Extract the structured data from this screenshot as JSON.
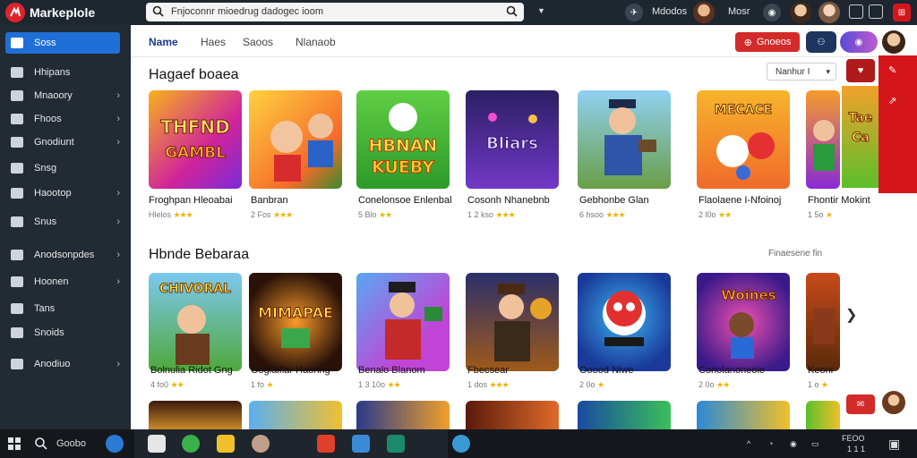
{
  "app": {
    "title": "Markeplole",
    "logo_icon": "marketplace-logo-icon"
  },
  "search": {
    "value": "Fnjoconnr mioedrug dadogec ioom"
  },
  "topbar": {
    "label_1": "Mdodos",
    "label_2": "Mosr"
  },
  "sidebar": {
    "items": [
      {
        "label": "Soss",
        "icon": "home-icon",
        "active": true,
        "chevron": false
      },
      {
        "label": "Hhipans",
        "icon": "grid-icon",
        "active": false,
        "chevron": false
      },
      {
        "label": "Mnaoory",
        "icon": "folder-icon",
        "active": false,
        "chevron": true
      },
      {
        "label": "Fhoos",
        "icon": "book-icon",
        "active": false,
        "chevron": true
      },
      {
        "label": "Gnodiunt",
        "icon": "gamepad-icon",
        "active": false,
        "chevron": true
      },
      {
        "label": "Snsg",
        "icon": "tag-icon",
        "active": false,
        "chevron": false
      },
      {
        "label": "Haootop",
        "icon": "monitor-icon",
        "active": false,
        "chevron": true
      },
      {
        "label": "Snus",
        "icon": "settings-icon",
        "active": false,
        "chevron": true
      },
      {
        "label": "Anodsonpdes",
        "icon": "puzzle-icon",
        "active": false,
        "chevron": true
      },
      {
        "label": "Hoonen",
        "icon": "list-icon",
        "active": false,
        "chevron": true
      },
      {
        "label": "Tans",
        "icon": "star-icon",
        "active": false,
        "chevron": false
      },
      {
        "label": "Snoids",
        "icon": "layers-icon",
        "active": false,
        "chevron": false
      },
      {
        "label": "Anodiuo",
        "icon": "trophy-icon",
        "active": false,
        "chevron": true
      }
    ]
  },
  "tabs": [
    {
      "label": "Name",
      "active": true
    },
    {
      "label": "Haes",
      "active": false
    },
    {
      "label": "Saoos",
      "active": false
    },
    {
      "label": "Nlanaob",
      "active": false
    }
  ],
  "header_actions": {
    "primary_label": "Gnoeos"
  },
  "section_1": {
    "title": "Hagaef boaea",
    "sort_label": "Nanhur I",
    "cards": [
      {
        "title": "Froghpan Hleoabai",
        "rating_text": "Hlelos",
        "stars": "★★★"
      },
      {
        "title": "Banbran",
        "rating_text": "2 Fos",
        "stars": "★★★"
      },
      {
        "title": "Conelonsoe Enlenbal",
        "rating_text": "5 Blo",
        "stars": "★★"
      },
      {
        "title": "Cosonh Nhanebnb",
        "rating_text": "1 2 kso",
        "stars": "★★★"
      },
      {
        "title": "Gebhonbe Glan",
        "rating_text": "6 hsoo",
        "stars": "★★★"
      },
      {
        "title": "Flaolaene I-Nfoinoj",
        "rating_text": "2 l0o",
        "stars": "★★"
      },
      {
        "title": "Fhontir Mokint",
        "rating_text": "1 5o",
        "stars": "★"
      }
    ]
  },
  "section_2": {
    "title": "Hbnde Bebaraa",
    "see_all": "Finaesene fin",
    "cards": [
      {
        "title": "Bolnulia Ridot Gng",
        "rating_text": "4 fo0",
        "stars": "★★"
      },
      {
        "title": "Ooglaiflar Haonng",
        "rating_text": "1 fo",
        "stars": "★"
      },
      {
        "title": "Benalo Blanom",
        "rating_text": "1 3 10o",
        "stars": "★★"
      },
      {
        "title": "Fbecsear",
        "rating_text": "1 dos",
        "stars": "★★★"
      },
      {
        "title": "Ooood Niwe",
        "rating_text": "2 0o",
        "stars": "★"
      },
      {
        "title": "Conolanoneoie",
        "rating_text": "2 0o",
        "stars": "★★"
      },
      {
        "title": "Keoni",
        "rating_text": "1 o",
        "stars": "★"
      }
    ]
  },
  "taskbar": {
    "search_label": "Goobo",
    "time": "FEOO",
    "date": "1 1 1"
  },
  "colors": {
    "topbar": "#1e2630",
    "sidebar": "#222a33",
    "accent": "#1f6fd6",
    "brand_red": "#d4161b"
  }
}
